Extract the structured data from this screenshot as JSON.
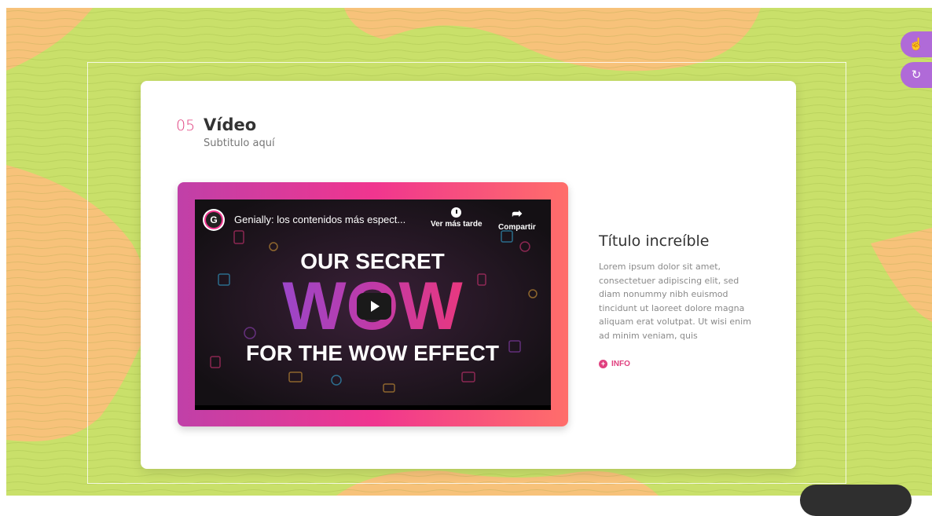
{
  "section": {
    "number": "05",
    "title": "Vídeo",
    "subtitle": "Subtitulo aquí"
  },
  "video": {
    "channel_icon": "genially-logo",
    "title": "Genially: los contenidos más espect...",
    "watch_later_label": "Ver más tarde",
    "share_label": "Compartir",
    "thumb_line1": "OUR SECRET",
    "thumb_big": "WOW",
    "thumb_line2": "FOR THE WOW EFFECT"
  },
  "side_panel": {
    "title": "Título increíble",
    "body": "Lorem ipsum dolor sit amet, consectetuer adipiscing elit, sed diam nonummy nibh euismod tincidunt ut laoreet dolore magna aliquam erat volutpat. Ut wisi enim ad minim veniam, quis",
    "info_label": "INFO"
  },
  "tools": [
    {
      "name": "hand-pointer-icon",
      "glyph": "☝"
    },
    {
      "name": "tap-icon",
      "glyph": "↻"
    }
  ],
  "colors": {
    "background_green": "#c9e06a",
    "background_orange": "#f7c27a",
    "accent_pink": "#e0407f",
    "tool_purple": "#b06ad8"
  }
}
